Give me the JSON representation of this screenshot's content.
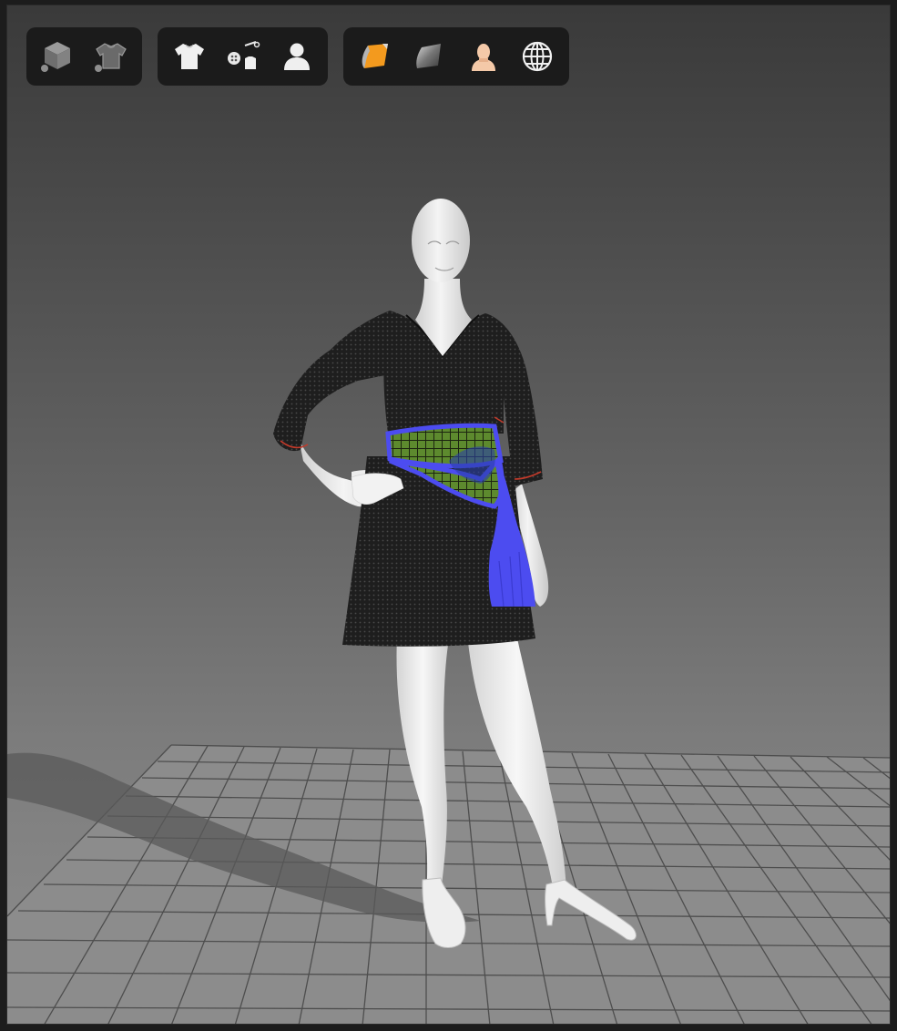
{
  "toolbar_groups": [
    {
      "tools": [
        {
          "icon": "avatar-cube-icon"
        },
        {
          "icon": "garment-tshirt-dark-icon"
        }
      ]
    },
    {
      "tools": [
        {
          "icon": "tshirt-icon"
        },
        {
          "icon": "trims-buttons-icon"
        },
        {
          "icon": "avatar-user-icon"
        }
      ]
    },
    {
      "tools": [
        {
          "icon": "fabric-texture-icon"
        },
        {
          "icon": "surface-shaded-icon"
        },
        {
          "icon": "skin-avatar-icon"
        },
        {
          "icon": "globe-icon"
        }
      ]
    }
  ],
  "colors": {
    "viewport_top": "#3a3a3a",
    "viewport_bottom": "#8e8e8e",
    "toolbar_bg": "#1b1b1b",
    "dress": "#1e1e1e",
    "belt_blue": "#4c4cf0",
    "belt_green": "#5d8a2e",
    "stitch_red": "#c23a2a",
    "avatar_skin": "#e9e9e9",
    "fabric_orange": "#f39a1e"
  }
}
